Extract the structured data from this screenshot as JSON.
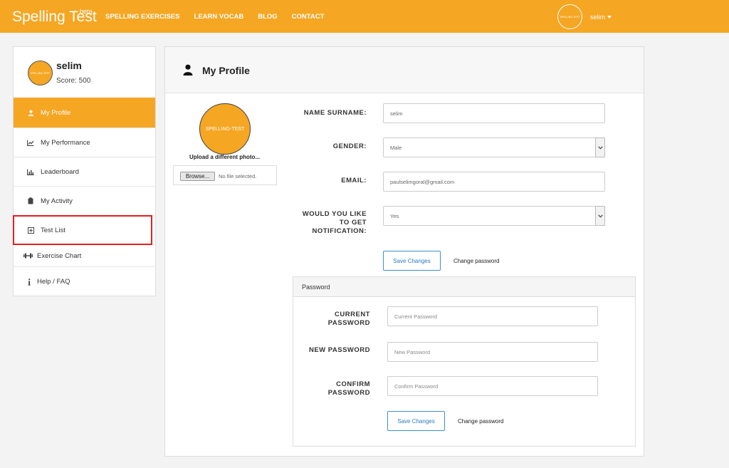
{
  "brand": {
    "name": "Spelling Test",
    "badge": "beta"
  },
  "nav": {
    "links": [
      "SPELLING EXERCISES",
      "LEARN VOCAB",
      "BLOG",
      "CONTACT"
    ],
    "avatar_text": "SPELLING-TEST",
    "user": "selim"
  },
  "sidebar": {
    "avatar_text": "SPELLING-TEST",
    "name": "selim",
    "score": "Score: 500",
    "items": [
      {
        "label": "My Profile",
        "icon": "user-icon"
      },
      {
        "label": "My Performance",
        "icon": "line-chart-icon"
      },
      {
        "label": "Leaderboard",
        "icon": "bar-chart-icon"
      },
      {
        "label": "My Activity",
        "icon": "clipboard-icon"
      },
      {
        "label": "Test List",
        "icon": "plus-square-icon"
      },
      {
        "label": "Exercise Chart",
        "icon": "dumbbell-icon"
      },
      {
        "label": "Help / FAQ",
        "icon": "info-icon"
      }
    ]
  },
  "profile": {
    "title": "My Profile",
    "avatar_text": "SPELLING-TEST",
    "upload_label": "Upload a different photo...",
    "browse_label": "Browse...",
    "file_status": "No file selected.",
    "fields": {
      "name_label": "NAME SURNAME:",
      "name_value": "selim",
      "gender_label": "GENDER:",
      "gender_value": "Male",
      "email_label": "EMAIL:",
      "email_value": "paulselimgoral@gmail.com",
      "notify_label_1": "WOULD YOU LIKE",
      "notify_label_2": "TO GET",
      "notify_label_3": "NOTIFICATION:",
      "notify_value": "Yes"
    },
    "save_label": "Save Changes",
    "change_password_label": "Change password"
  },
  "password": {
    "panel_title": "Password",
    "current_label_1": "CURRENT",
    "current_label_2": "PASSWORD",
    "current_placeholder": "Current Password",
    "new_label": "NEW PASSWORD",
    "new_placeholder": "New Password",
    "confirm_label_1": "CONFIRM",
    "confirm_label_2": "PASSWORD",
    "confirm_placeholder": "Confirm Password",
    "save_label": "Save Changes",
    "change_password_label": "Change password"
  },
  "colors": {
    "accent": "#f5a623",
    "highlight": "#e3201f",
    "button_border": "#3b8fd6"
  }
}
